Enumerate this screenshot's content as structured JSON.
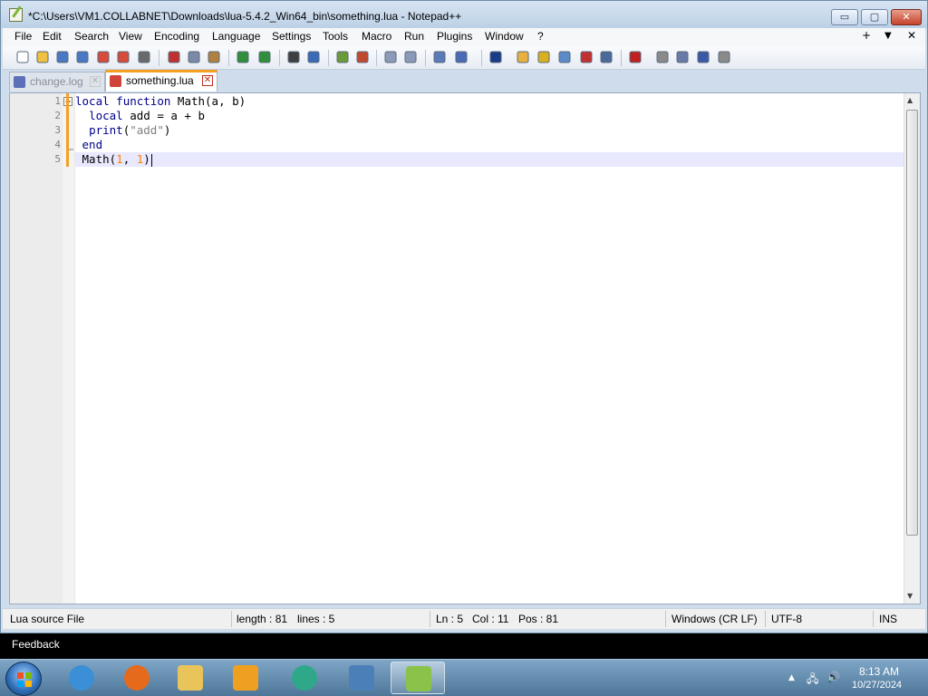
{
  "window": {
    "title": "*C:\\Users\\VM1.COLLABNET\\Downloads\\lua-5.4.2_Win64_bin\\something.lua - Notepad++",
    "minimize_glyph": "▭",
    "maximize_glyph": "▢",
    "close_glyph": "✕"
  },
  "menu": {
    "items": [
      "File",
      "Edit",
      "Search",
      "View",
      "Encoding",
      "Language",
      "Settings",
      "Tools",
      "Macro",
      "Run",
      "Plugins",
      "Window",
      "?"
    ],
    "right": [
      "+",
      "▼",
      "✕"
    ]
  },
  "toolbar": {
    "icons": [
      "new-file-icon",
      "open-file-icon",
      "save-icon",
      "save-all-icon",
      "close-icon",
      "close-all-icon",
      "print-icon",
      "cut-icon",
      "copy-icon",
      "paste-icon",
      "undo-icon",
      "redo-icon",
      "find-icon",
      "replace-icon",
      "zoom-in-icon",
      "zoom-out-icon",
      "sync-vertical-icon",
      "sync-horizontal-icon",
      "word-wrap-icon",
      "show-all-chars-icon",
      "indent-guide-icon",
      "doc-map-icon",
      "function-list-icon",
      "folder-workspace-icon",
      "document-list-icon",
      "monitoring-icon",
      "record-macro-icon",
      "stop-macro-icon",
      "play-macro-icon",
      "run-macro-multiple-icon",
      "save-macro-icon"
    ]
  },
  "tabs": [
    {
      "label": "change.log",
      "active": false
    },
    {
      "label": "something.lua",
      "active": true
    }
  ],
  "editor": {
    "line_numbers": [
      "1",
      "2",
      "3",
      "4",
      "5"
    ],
    "lines": [
      [
        {
          "t": "local",
          "c": "kw"
        },
        {
          "t": " ",
          "c": ""
        },
        {
          "t": "function",
          "c": "kw"
        },
        {
          "t": " Math(a, b)",
          "c": ""
        }
      ],
      [
        {
          "t": "  ",
          "c": ""
        },
        {
          "t": "local",
          "c": "kw"
        },
        {
          "t": " add = a + b",
          "c": ""
        }
      ],
      [
        {
          "t": "  ",
          "c": ""
        },
        {
          "t": "print",
          "c": "fn"
        },
        {
          "t": "(",
          "c": ""
        },
        {
          "t": "\"add\"",
          "c": "str"
        },
        {
          "t": ")",
          "c": ""
        }
      ],
      [
        {
          "t": " ",
          "c": ""
        },
        {
          "t": "end",
          "c": "kw"
        }
      ],
      [
        {
          "t": " Math(",
          "c": ""
        },
        {
          "t": "1",
          "c": "num"
        },
        {
          "t": ", ",
          "c": ""
        },
        {
          "t": "1",
          "c": "num"
        },
        {
          "t": ")",
          "c": ""
        }
      ]
    ],
    "current_line": 5
  },
  "status": {
    "file_type": "Lua source File",
    "length": "length : 81",
    "lines": "lines : 5",
    "ln": "Ln : 5",
    "col": "Col : 11",
    "pos": "Pos : 81",
    "eol": "Windows (CR LF)",
    "encoding": "UTF-8",
    "mode": "INS"
  },
  "feedback": {
    "label": "Feedback"
  },
  "taskbar": {
    "apps": [
      {
        "name": "internet-explorer-icon",
        "active": false,
        "color": "#3a8fd6"
      },
      {
        "name": "firefox-icon",
        "active": false,
        "color": "#e66a1c"
      },
      {
        "name": "file-explorer-icon",
        "active": false,
        "color": "#e8c45a"
      },
      {
        "name": "media-player-icon",
        "active": false,
        "color": "#f0a020"
      },
      {
        "name": "edge-icon",
        "active": false,
        "color": "#2fa88a"
      },
      {
        "name": "remote-desktop-icon",
        "active": false,
        "color": "#4b7fb8"
      },
      {
        "name": "notepad-plus-plus-icon",
        "active": true,
        "color": "#8bc24a"
      }
    ],
    "clock_time": "8:13 AM",
    "clock_date": "10/27/2024",
    "tray_up": "▲",
    "tray_network": "🖧",
    "tray_volume": "🔊"
  }
}
